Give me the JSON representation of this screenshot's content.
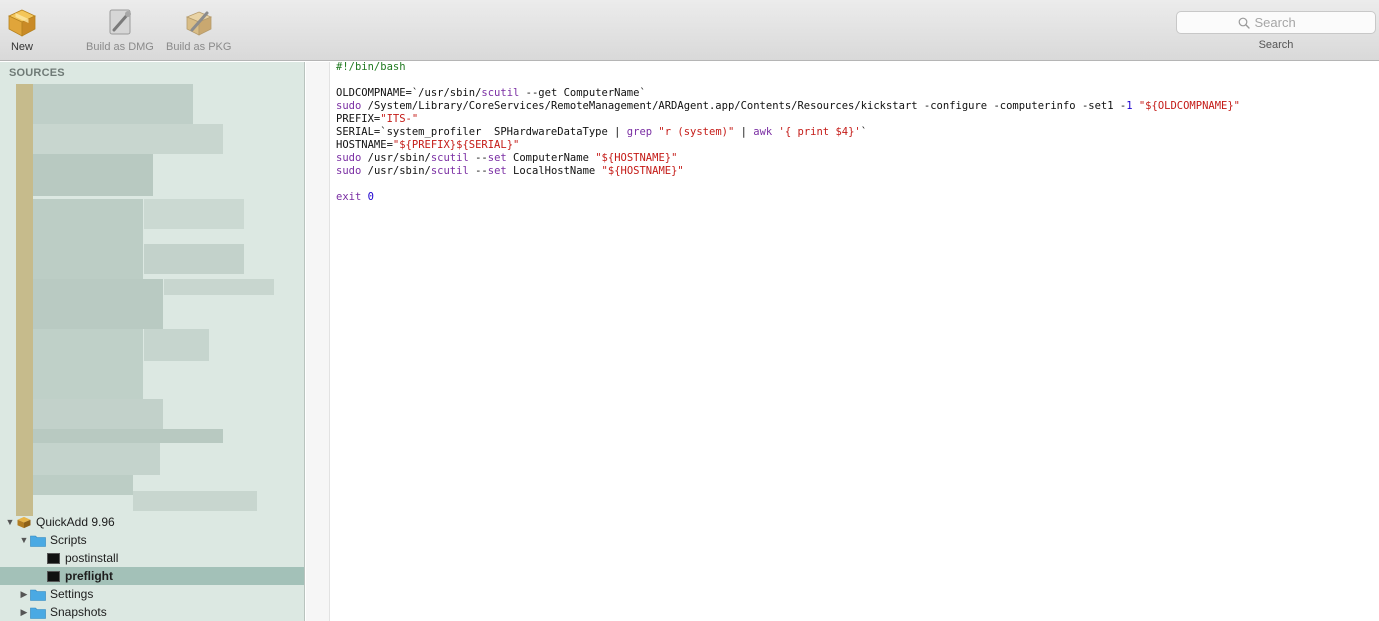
{
  "toolbar": {
    "new_label": "New",
    "build_dmg_label": "Build as DMG",
    "build_pkg_label": "Build as PKG",
    "search_placeholder": "Search",
    "search_label": "Search"
  },
  "sidebar": {
    "header": "SOURCES",
    "tree": [
      {
        "label": "QuickAdd 9.96",
        "type": "package",
        "level": 0,
        "expanded": true
      },
      {
        "label": "Scripts",
        "type": "folder",
        "level": 1,
        "expanded": true
      },
      {
        "label": "postinstall",
        "type": "script",
        "level": 2
      },
      {
        "label": "preflight",
        "type": "script",
        "level": 2,
        "selected": true
      },
      {
        "label": "Settings",
        "type": "folder",
        "level": 1,
        "expanded": false
      },
      {
        "label": "Snapshots",
        "type": "folder",
        "level": 1,
        "expanded": false
      }
    ]
  },
  "editor": {
    "lines": [
      [
        {
          "t": "#!/bin/bash",
          "c": "comment"
        }
      ],
      [],
      [
        {
          "t": "OLDCOMPNAME=`/usr/sbin/",
          "c": ""
        },
        {
          "t": "scutil",
          "c": "cmd"
        },
        {
          "t": " --get ComputerName`",
          "c": ""
        }
      ],
      [
        {
          "t": "sudo",
          "c": "cmd"
        },
        {
          "t": " /System/Library/CoreServices/RemoteManagement/ARDAgent.app/Contents/Resources/kickstart -configure -computerinfo -set1 -",
          "c": ""
        },
        {
          "t": "1",
          "c": "num"
        },
        {
          "t": " ",
          "c": ""
        },
        {
          "t": "\"${OLDCOMPNAME}\"",
          "c": "str"
        }
      ],
      [
        {
          "t": "PREFIX=",
          "c": ""
        },
        {
          "t": "\"ITS-\"",
          "c": "str"
        }
      ],
      [
        {
          "t": "SERIAL=`system_profiler  SPHardwareDataType | ",
          "c": ""
        },
        {
          "t": "grep",
          "c": "cmd"
        },
        {
          "t": " ",
          "c": ""
        },
        {
          "t": "\"r (system)\"",
          "c": "str"
        },
        {
          "t": " | ",
          "c": ""
        },
        {
          "t": "awk",
          "c": "cmd"
        },
        {
          "t": " ",
          "c": ""
        },
        {
          "t": "'{ print $4}'",
          "c": "str"
        },
        {
          "t": "`",
          "c": ""
        }
      ],
      [
        {
          "t": "HOSTNAME=",
          "c": ""
        },
        {
          "t": "\"${PREFIX}${SERIAL}\"",
          "c": "str"
        }
      ],
      [
        {
          "t": "sudo",
          "c": "cmd"
        },
        {
          "t": " /usr/sbin/",
          "c": ""
        },
        {
          "t": "scutil",
          "c": "cmd"
        },
        {
          "t": " --",
          "c": ""
        },
        {
          "t": "set",
          "c": "cmd"
        },
        {
          "t": " ComputerName ",
          "c": ""
        },
        {
          "t": "\"${HOSTNAME}\"",
          "c": "str"
        }
      ],
      [
        {
          "t": "sudo",
          "c": "cmd"
        },
        {
          "t": " /usr/sbin/",
          "c": ""
        },
        {
          "t": "scutil",
          "c": "cmd"
        },
        {
          "t": " --",
          "c": ""
        },
        {
          "t": "set",
          "c": "cmd"
        },
        {
          "t": " LocalHostName ",
          "c": ""
        },
        {
          "t": "\"${HOSTNAME}\"",
          "c": "str"
        }
      ],
      [],
      [
        {
          "t": "exit",
          "c": "cmd"
        },
        {
          "t": " ",
          "c": ""
        },
        {
          "t": "0",
          "c": "num"
        }
      ]
    ]
  }
}
